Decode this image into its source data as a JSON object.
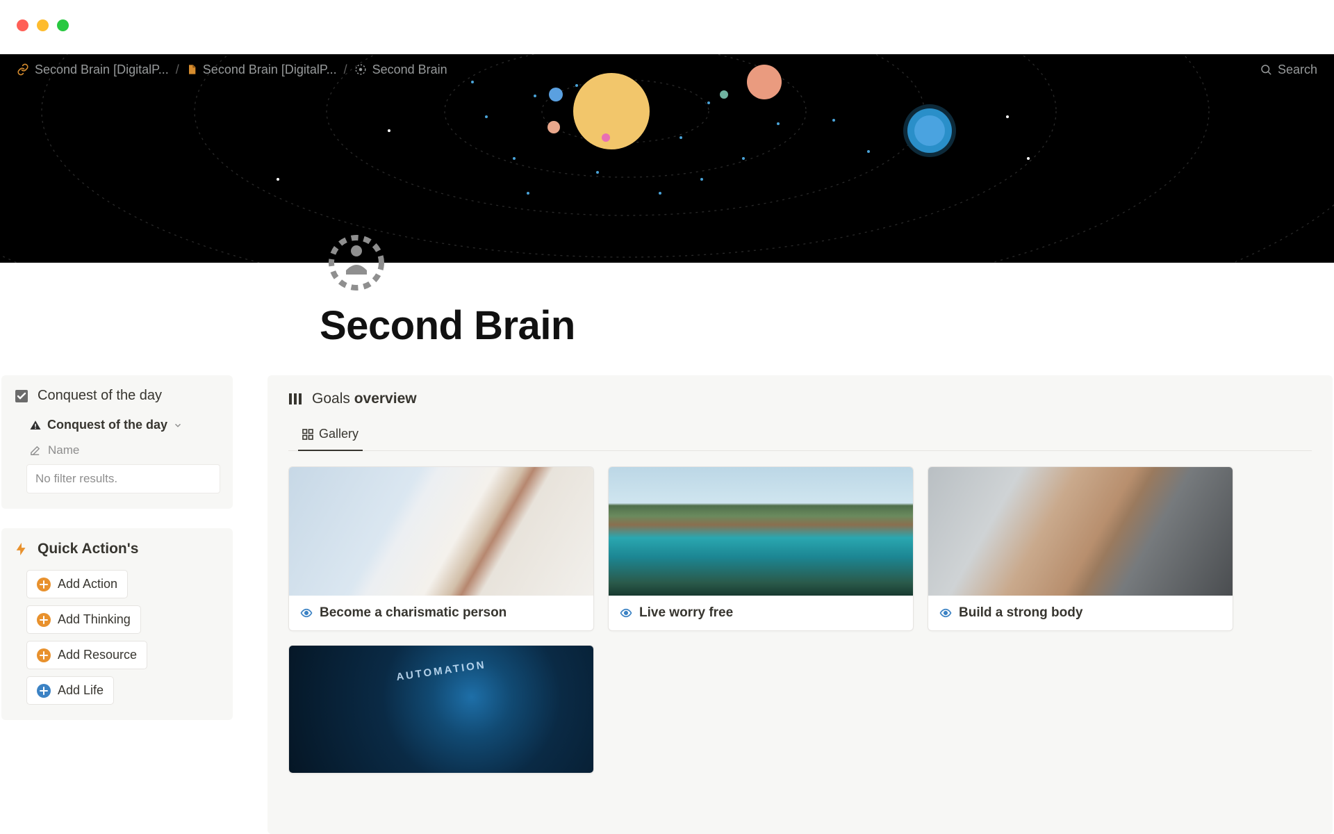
{
  "breadcrumbs": [
    {
      "label": "Second Brain [DigitalP..."
    },
    {
      "label": "Second Brain [DigitalP..."
    },
    {
      "label": "Second Brain"
    }
  ],
  "search_label": "Search",
  "page": {
    "title": "Second Brain"
  },
  "conquest": {
    "title": "Conquest of the day",
    "subtitle": "Conquest of the day",
    "name_label": "Name",
    "empty": "No filter results."
  },
  "quick_actions": {
    "title": "Quick Action's",
    "items": [
      {
        "label": "Add Action",
        "color": "orange"
      },
      {
        "label": "Add Thinking",
        "color": "orange"
      },
      {
        "label": "Add Resource",
        "color": "orange"
      },
      {
        "label": "Add Life",
        "color": "blue"
      }
    ]
  },
  "goals": {
    "title_a": "Goals",
    "title_b": "overview",
    "tab": "Gallery",
    "cards": [
      {
        "title": "Become a charismatic person"
      },
      {
        "title": "Live worry free"
      },
      {
        "title": "Build a strong body"
      },
      {
        "title": ""
      }
    ]
  }
}
